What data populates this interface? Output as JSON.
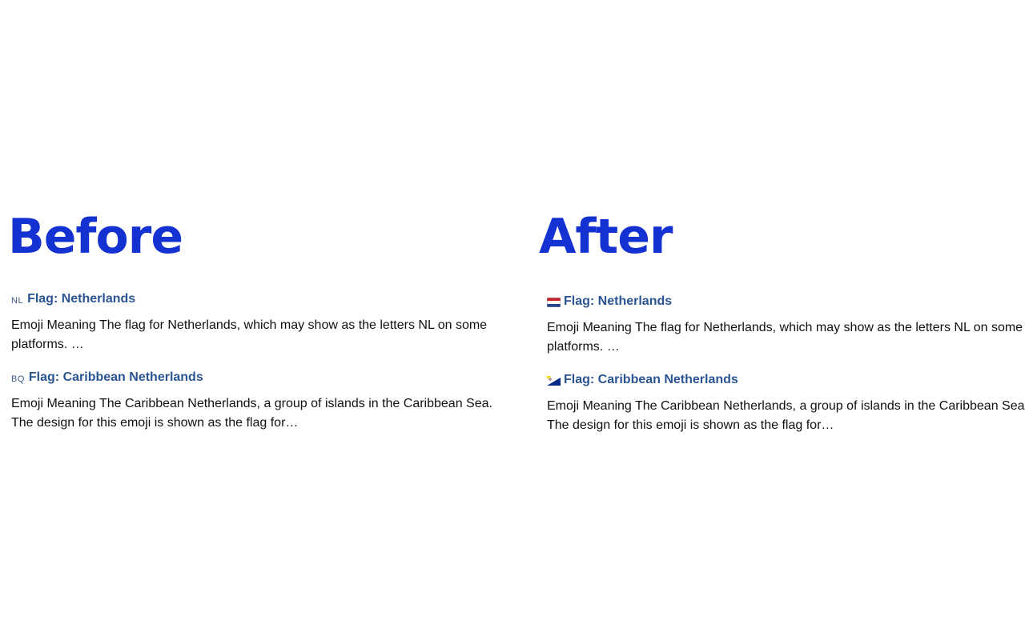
{
  "colors": {
    "accent": "#1432d2",
    "link": "#2b5592",
    "nl_red": "#c8222c",
    "nl_blue": "#21468b",
    "bq_blue": "#012a87",
    "bq_yellow": "#f9d90f"
  },
  "before": {
    "heading": "Before",
    "entries": [
      {
        "code": "NL",
        "title": "Flag: Netherlands",
        "description": "Emoji Meaning The flag for Netherlands, which may show as the letters NL on some platforms. …"
      },
      {
        "code": "BQ",
        "title": "Flag: Caribbean Netherlands",
        "description": "Emoji Meaning The Caribbean Netherlands, a group of islands in the Caribbean Sea. The design for this emoji is shown as the flag for…"
      }
    ]
  },
  "after": {
    "heading": "After",
    "entries": [
      {
        "icon": "netherlands-flag-icon",
        "title": "Flag: Netherlands",
        "description": "Emoji Meaning The flag for Netherlands, which may show as the letters NL on some platforms. …"
      },
      {
        "icon": "caribbean-netherlands-flag-icon",
        "title": "Flag: Caribbean Netherlands",
        "description": "Emoji Meaning The Caribbean Netherlands, a group of islands in the Caribbean Sea. The design for this emoji is shown as the flag for…"
      }
    ]
  }
}
